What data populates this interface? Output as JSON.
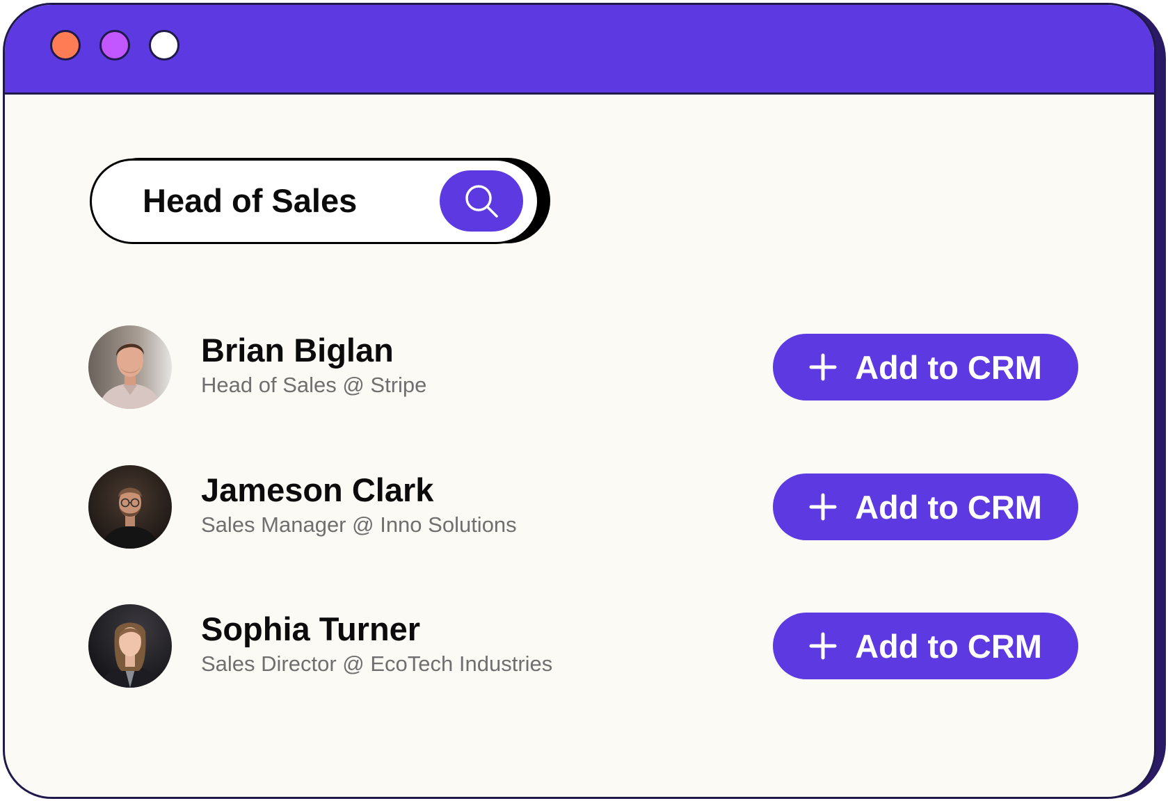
{
  "window": {
    "controls": [
      "close",
      "minimize",
      "maximize"
    ]
  },
  "search": {
    "query": "Head of Sales",
    "icon": "search-icon"
  },
  "results": [
    {
      "name": "Brian Biglan",
      "title": "Head of Sales @ Stripe",
      "button_label": "Add to CRM"
    },
    {
      "name": "Jameson Clark",
      "title": "Sales Manager @ Inno Solutions",
      "button_label": "Add to CRM"
    },
    {
      "name": "Sophia Turner",
      "title": "Sales Director @ EcoTech Industries",
      "button_label": "Add to CRM"
    }
  ],
  "colors": {
    "accent": "#5d39e2",
    "close_dot": "#ff7c55",
    "minimize_dot": "#c257ff",
    "maximize_dot": "#ffffff",
    "background": "#fcfaf5",
    "subtitle_text": "#6f6f6f"
  }
}
